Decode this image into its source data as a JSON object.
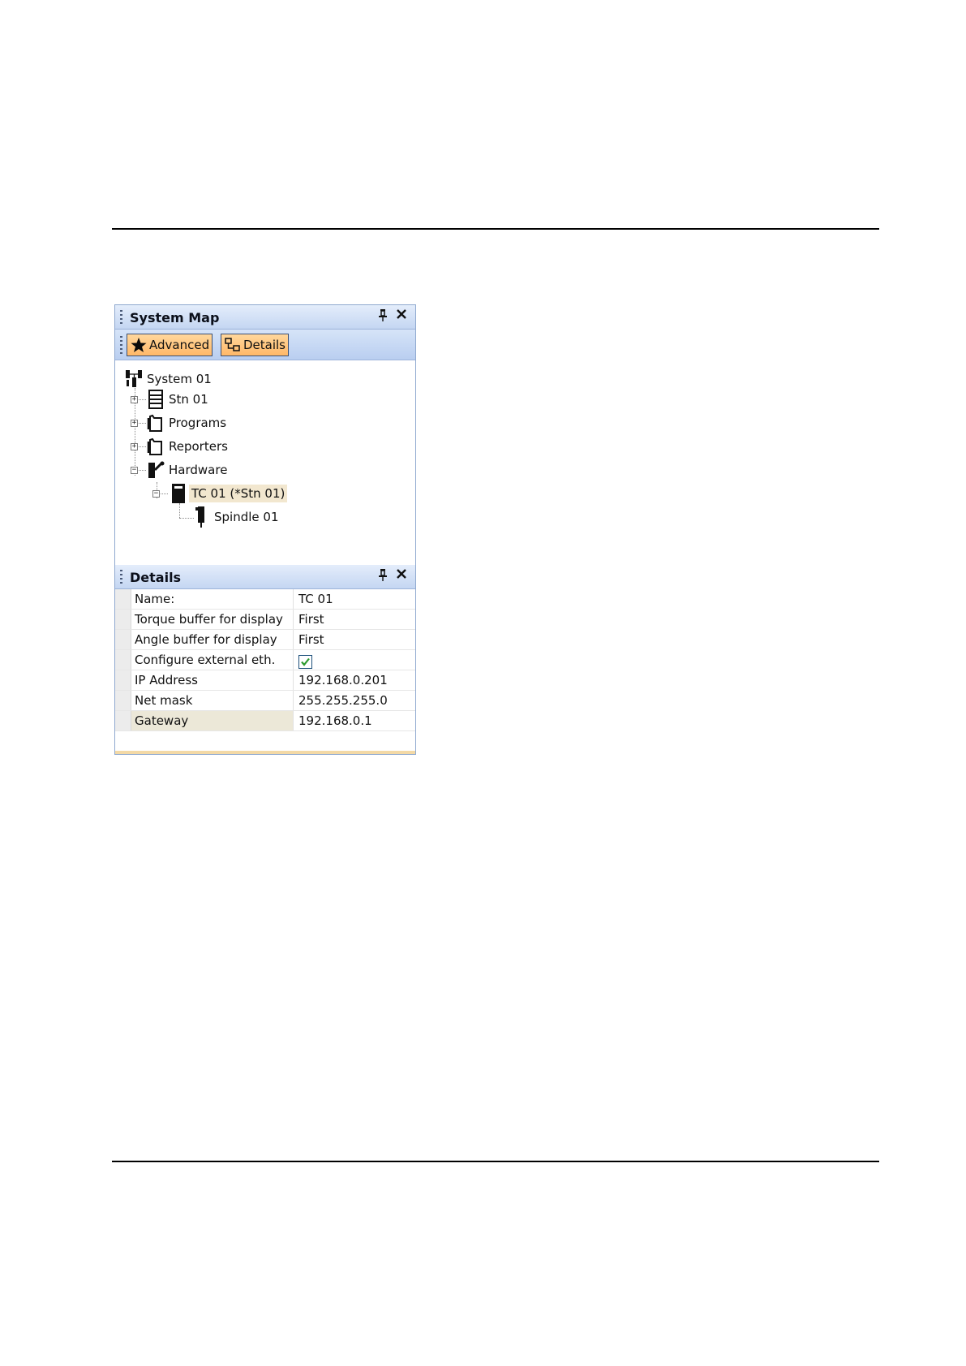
{
  "system_map": {
    "title": "System Map",
    "toolbar": {
      "advanced_label": "Advanced",
      "details_label": "Details"
    },
    "tree": {
      "root": "System 01",
      "stn": "Stn 01",
      "programs": "Programs",
      "reporters": "Reporters",
      "hardware": "Hardware",
      "controller": "TC 01 (*Stn 01)",
      "spindle": "Spindle 01"
    }
  },
  "details": {
    "title": "Details",
    "rows": [
      {
        "name": "Name:",
        "value": "TC 01"
      },
      {
        "name": "Torque buffer for display",
        "value": "First"
      },
      {
        "name": "Angle buffer for display",
        "value": "First"
      },
      {
        "name": "Configure external eth.",
        "value": "",
        "checked": true
      },
      {
        "name": "IP Address",
        "value": "192.168.0.201"
      },
      {
        "name": "Net mask",
        "value": "255.255.255.0"
      },
      {
        "name": "Gateway",
        "value": "192.168.0.1"
      }
    ]
  },
  "colors": {
    "button_active": "#ffb868",
    "titlebar": "#c4d6f2",
    "selected_row": "#ece8d8",
    "checkmark": "#2e9b2e"
  },
  "icons": {
    "pin": "pin-icon",
    "close": "close-icon",
    "advanced": "star-icon",
    "details": "details-icon"
  }
}
